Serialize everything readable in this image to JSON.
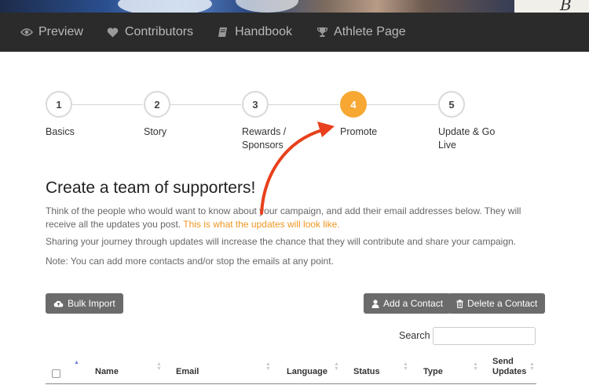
{
  "nav": {
    "items": [
      {
        "label": "Preview",
        "icon": "eye-icon"
      },
      {
        "label": "Contributors",
        "icon": "heart-icon"
      },
      {
        "label": "Handbook",
        "icon": "book-icon"
      },
      {
        "label": "Athlete Page",
        "icon": "trophy-icon"
      }
    ]
  },
  "stepper": {
    "current": 4,
    "steps": [
      {
        "number": "1",
        "label": "Basics"
      },
      {
        "number": "2",
        "label": "Story"
      },
      {
        "number": "3",
        "label": "Rewards / Sponsors"
      },
      {
        "number": "4",
        "label": "Promote"
      },
      {
        "number": "5",
        "label": "Update & Go Live"
      }
    ]
  },
  "content": {
    "title": "Create a team of supporters!",
    "intro": "Think of the people who would want to know about your campaign, and add their email addresses below. They will receive all the updates you post.",
    "intro_link": "This is what the updates will look like.",
    "sharing": "Sharing your journey through updates will increase the chance that they will contribute and share your campaign.",
    "note": "Note: You can add more contacts and/or stop the emails at any point."
  },
  "toolbar": {
    "bulk_import": "Bulk Import",
    "add_contact": "Add a Contact",
    "delete_contact": "Delete a Contact"
  },
  "search": {
    "label": "Search",
    "value": ""
  },
  "table": {
    "headers": {
      "name": "Name",
      "email": "Email",
      "language": "Language",
      "status": "Status",
      "type": "Type",
      "send_updates": "Send Updates"
    }
  },
  "colors": {
    "accent": "#f6a833",
    "link": "#f0961f",
    "nav_bg": "#2b2b2b",
    "button_bg": "#6b6b6b",
    "annotation_arrow": "#e8401c"
  }
}
